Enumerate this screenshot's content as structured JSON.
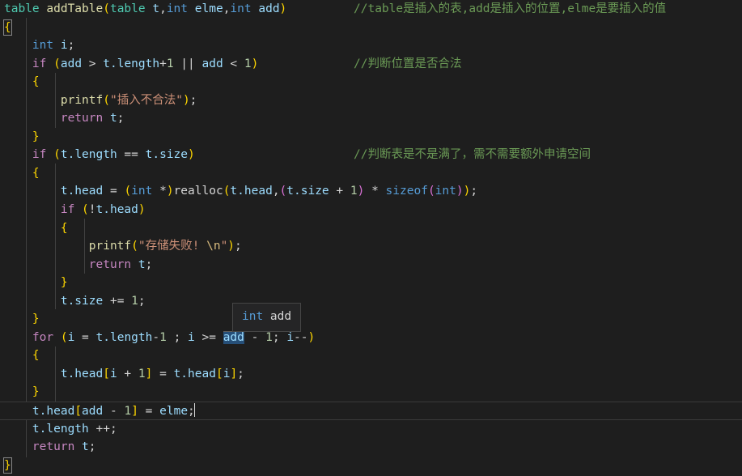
{
  "editor": {
    "background": "#1e1e1e",
    "foreground": "#d4d4d4",
    "font_size_px": 14.5,
    "line_height_px": 22.55
  },
  "colors": {
    "type": "#4ec9b0",
    "function": "#dcdcaa",
    "keyword": "#569cd6",
    "control": "#c586c0",
    "variable": "#9cdcfe",
    "number": "#b5cea8",
    "string": "#ce9178",
    "escape": "#d7ba7d",
    "comment": "#6a9955",
    "bracket1": "#ffd700",
    "bracket2": "#da70d6",
    "bracket3": "#179fff",
    "selection": "#264f78",
    "tooltip_bg": "#252526",
    "tooltip_border": "#454545",
    "indent_guide": "#404040",
    "current_line_border": "#3a3a3a"
  },
  "code": {
    "language": "c",
    "lines": [
      "table addTable(table t,int elme,int add)",
      "{",
      "    int i;",
      "    if (add > t.length+1 || add < 1)",
      "    {",
      "        printf(\"插入不合法\");",
      "        return t;",
      "    }",
      "    if (t.length == t.size)",
      "    {",
      "        t.head = (int *)realloc(t.head,(t.size + 1) * sizeof(int));",
      "        if (!t.head)",
      "        {",
      "            printf(\"存储失败! \\n\");",
      "            return t;",
      "        }",
      "        t.size += 1;",
      "    }",
      "    for (i = t.length-1 ; i >= add - 1; i--)",
      "    {",
      "        t.head[i + 1] = t.head[i];",
      "    }",
      "    t.head[add - 1] = elme;",
      "    t.length ++;",
      "    return t;",
      "}"
    ]
  },
  "tokens": {
    "l1_type": "table",
    "l1_space": " ",
    "l1_func": "addTable",
    "l1_paren_open": "(",
    "l1_p1_type": "table",
    "l1_p1_name": " t",
    "l1_comma1": ",",
    "l1_p2_type": "int",
    "l1_p2_name": " elme",
    "l1_comma2": ",",
    "l1_p3_type": "int",
    "l1_p3_name": " add",
    "l1_paren_close": ")",
    "brace_open": "{",
    "brace_close": "}",
    "l3_indent": "    ",
    "l3_kw": "int",
    "l3_var": " i",
    "l3_semi": ";",
    "l4_indent": "    ",
    "l4_if": "if",
    "l4_sp": " ",
    "l4_po": "(",
    "l4_add1": "add",
    "l4_gt": " > ",
    "l4_tlen": "t.length",
    "l4_plus": "+",
    "l4_one": "1",
    "l4_or": " || ",
    "l4_add2": "add",
    "l4_lt": " < ",
    "l4_one2": "1",
    "l4_pc": ")",
    "l5_indent": "    ",
    "l6_indent": "        ",
    "l6_printf": "printf",
    "l6_po": "(",
    "l6_str": "\"插入不合法\"",
    "l6_pc": ")",
    "l6_semi": ";",
    "l7_indent": "        ",
    "l7_return": "return",
    "l7_t": " t",
    "l7_semi": ";",
    "l8_indent": "    ",
    "l9_indent": "    ",
    "l9_if": "if",
    "l9_po": " (",
    "l9_tlen": "t.length",
    "l9_eq": " == ",
    "l9_tsize": "t.size",
    "l9_pc": ")",
    "l10_indent": "    ",
    "l11_indent": "        ",
    "l11_thead": "t.head",
    "l11_assign": " = ",
    "l11_po1": "(",
    "l11_int": "int",
    "l11_star": " *",
    "l11_pc1": ")",
    "l11_realloc": "realloc",
    "l11_po2": "(",
    "l11_thead2": "t.head",
    "l11_comma": ",",
    "l11_po3": "(",
    "l11_tsize": "t.size",
    "l11_plus": " + ",
    "l11_one": "1",
    "l11_pc3": ")",
    "l11_mul": " * ",
    "l11_sizeof": "sizeof",
    "l11_po4": "(",
    "l11_int2": "int",
    "l11_pc4": ")",
    "l11_pc2": ")",
    "l11_semi": ";",
    "l12_indent": "        ",
    "l12_if": "if",
    "l12_po": " (",
    "l12_not": "!",
    "l12_thead": "t.head",
    "l12_pc": ")",
    "l13_indent": "        ",
    "l14_indent": "            ",
    "l14_printf": "printf",
    "l14_po": "(",
    "l14_str_open": "\"存储失败! ",
    "l14_esc": "\\n",
    "l14_str_close": "\"",
    "l14_pc": ")",
    "l14_semi": ";",
    "l15_indent": "            ",
    "l15_return": "return",
    "l15_t": " t",
    "l15_semi": ";",
    "l16_indent": "        ",
    "l17_indent": "        ",
    "l17_tsize": "t.size",
    "l17_op": " += ",
    "l17_one": "1",
    "l17_semi": ";",
    "l18_indent": "    ",
    "l19_indent": "    ",
    "l19_for": "for",
    "l19_po": " (",
    "l19_i": "i",
    "l19_assign": " = ",
    "l19_tlen": "t.length",
    "l19_minus": "-",
    "l19_one": "1",
    "l19_semi1": " ; ",
    "l19_i2": "i",
    "l19_ge": " >= ",
    "l19_add": "add",
    "l19_sub": " - ",
    "l19_one2": "1",
    "l19_semi2": "; ",
    "l19_i3": "i",
    "l19_dec": "--",
    "l19_pc": ")",
    "l20_indent": "    ",
    "l21_indent": "        ",
    "l21_thead": "t.head",
    "l21_bo": "[",
    "l21_i": "i",
    "l21_plus": " + ",
    "l21_one": "1",
    "l21_bc": "]",
    "l21_assign": " = ",
    "l21_thead2": "t.head",
    "l21_bo2": "[",
    "l21_i2": "i",
    "l21_bc2": "]",
    "l21_semi": ";",
    "l22_indent": "    ",
    "l23_indent": "    ",
    "l23_thead": "t.head",
    "l23_bo": "[",
    "l23_add": "add",
    "l23_sub": " - ",
    "l23_one": "1",
    "l23_bc": "]",
    "l23_assign": " = ",
    "l23_elme": "elme",
    "l23_semi": ";",
    "l24_indent": "    ",
    "l24_tlen": "t.length",
    "l24_inc": " ++",
    "l24_semi": ";",
    "l25_indent": "    ",
    "l25_return": "return",
    "l25_t": " t",
    "l25_semi": ";"
  },
  "comments": [
    {
      "line": 1,
      "text": "//table是插入的表,add是插入的位置,elme是要插入的值"
    },
    {
      "line": 4,
      "text": "//判断位置是否合法"
    },
    {
      "line": 9,
      "text": "//判断表是不是满了，需不需要额外申请空间"
    }
  ],
  "hover_tooltip": {
    "visible": true,
    "type_keyword": "int",
    "symbol": " add"
  }
}
